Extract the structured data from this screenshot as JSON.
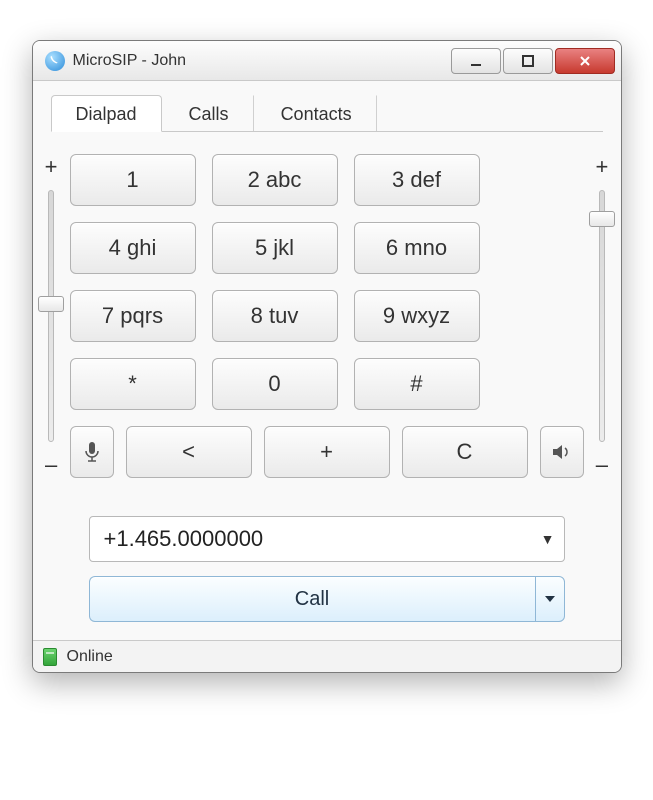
{
  "window": {
    "title": "MicroSIP - John"
  },
  "tabs": [
    {
      "label": "Dialpad",
      "active": true
    },
    {
      "label": "Calls",
      "active": false
    },
    {
      "label": "Contacts",
      "active": false
    }
  ],
  "volume": {
    "plus": "+",
    "minus": "–",
    "left_thumb_pct": 42,
    "right_thumb_pct": 8
  },
  "keypad": [
    {
      "label": "1"
    },
    {
      "label": "2 abc"
    },
    {
      "label": "3 def"
    },
    {
      "label": "4 ghi"
    },
    {
      "label": "5 jkl"
    },
    {
      "label": "6 mno"
    },
    {
      "label": "7 pqrs"
    },
    {
      "label": "8 tuv"
    },
    {
      "label": "9 wxyz"
    },
    {
      "label": "*"
    },
    {
      "label": "0"
    },
    {
      "label": "#"
    },
    {
      "label": "<"
    },
    {
      "label": "+"
    },
    {
      "label": "C"
    }
  ],
  "number_entry": {
    "value": "+1.465.0000000"
  },
  "call_button": {
    "label": "Call"
  },
  "status": {
    "text": "Online"
  }
}
